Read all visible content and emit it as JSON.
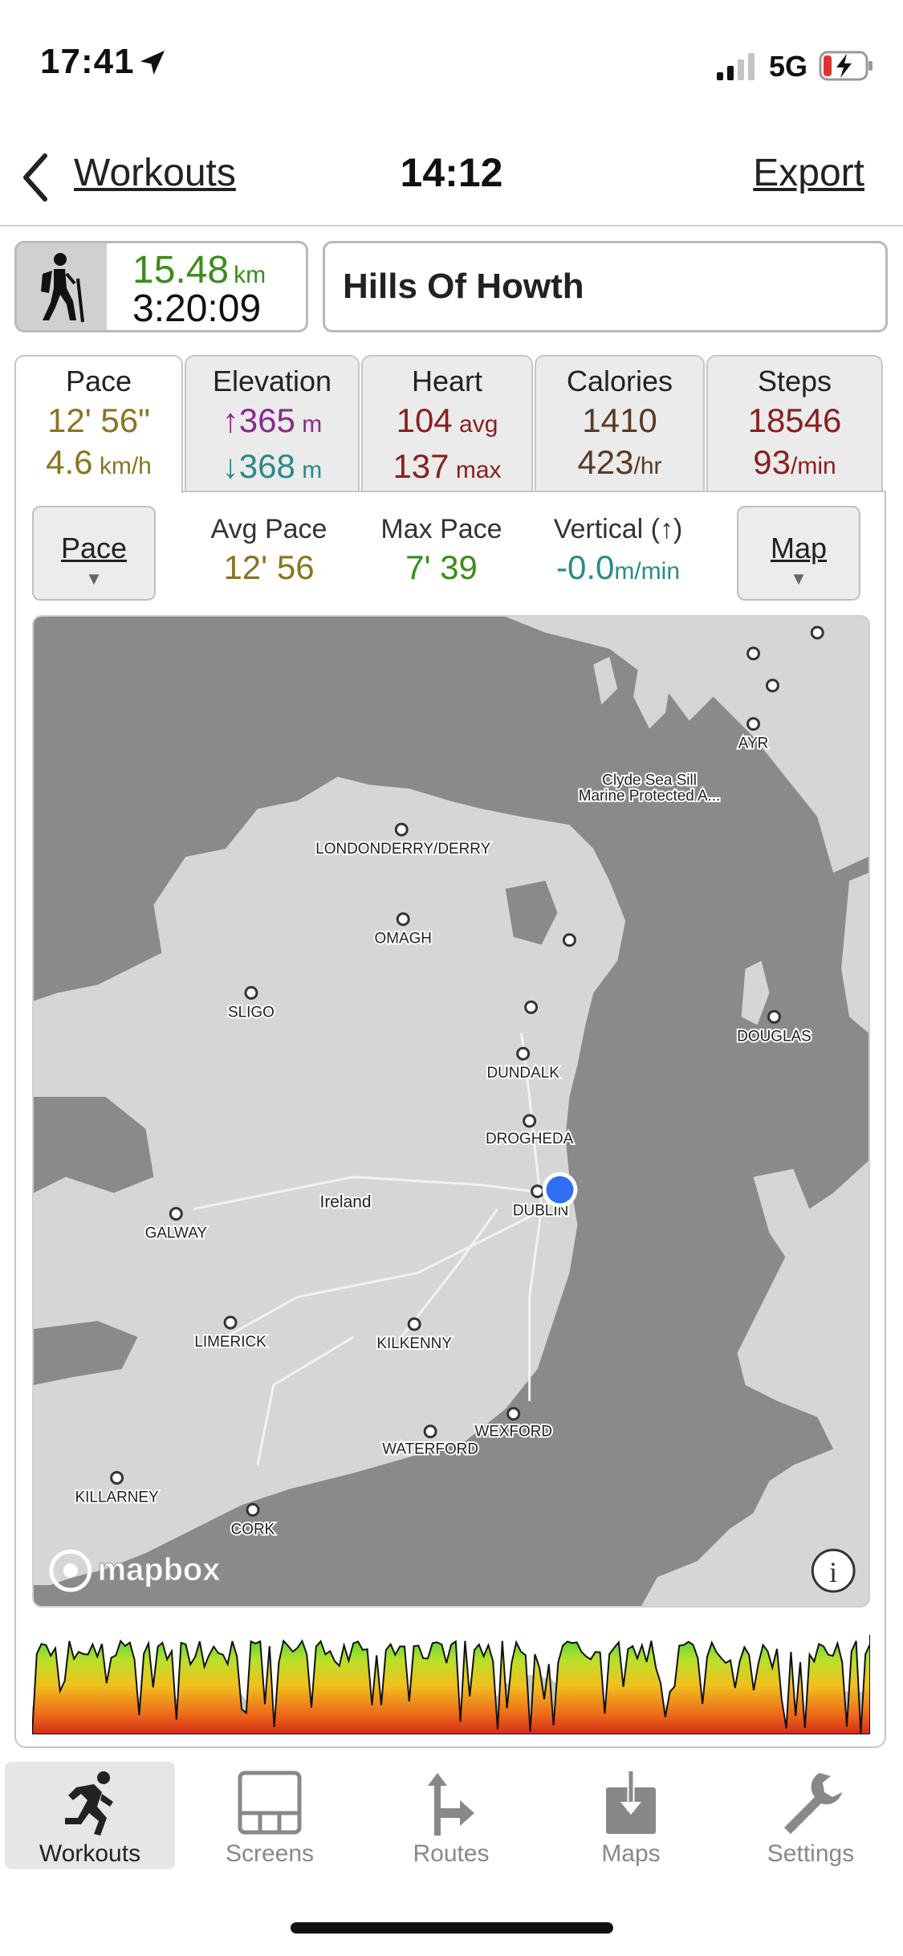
{
  "status_bar": {
    "time": "17:41",
    "network": "5G",
    "icons": [
      "location-arrow-icon",
      "signal-icon",
      "battery-charging-icon"
    ]
  },
  "nav": {
    "back_label": "Workouts",
    "title": "14:12",
    "export_label": "Export"
  },
  "summary": {
    "activity_icon": "hiking-icon",
    "distance": "15.48",
    "distance_unit": "km",
    "duration": "3:20:09",
    "workout_name": "Hills Of Howth"
  },
  "tabs": {
    "pace": {
      "label": "Pace",
      "line1": "12' 56\"",
      "line2": "4.6",
      "line2_unit": " km/h"
    },
    "elevation": {
      "label": "Elevation",
      "ascent": "↑365",
      "ascent_unit": " m",
      "descent": "↓368",
      "descent_unit": " m"
    },
    "heart": {
      "label": "Heart",
      "avg": "104",
      "avg_unit": " avg",
      "max": "137",
      "max_unit": " max"
    },
    "calories": {
      "label": "Calories",
      "total": "1410",
      "rate": "423",
      "rate_unit": "/hr"
    },
    "steps": {
      "label": "Steps",
      "total": "18546",
      "rate": "93",
      "rate_unit": "/min"
    }
  },
  "detail": {
    "left_selector": "Pace",
    "right_selector": "Map",
    "metrics": [
      {
        "label": "Avg Pace",
        "value": "12' 56",
        "unit": ""
      },
      {
        "label": "Max Pace",
        "value": "7' 39",
        "unit": ""
      },
      {
        "label": "Vertical (↑)",
        "value": "-0.0",
        "unit": "m/min"
      }
    ]
  },
  "map": {
    "places": [
      "LONDONDERRY/DERRY",
      "OMAGH",
      "SLIGO",
      "DUNDALK",
      "DROGHEDA",
      "DUBLIN",
      "GALWAY",
      "Ireland",
      "LIMERICK",
      "KILKENNY",
      "WEXFORD",
      "WATERFORD",
      "KILLARNEY",
      "CORK",
      "AYR",
      "DOUGLAS"
    ],
    "marine_line1": "Clyde Sea Sill",
    "marine_line2": "Marine Protected A...",
    "attribution": "mapbox",
    "info_icon": "info-icon"
  },
  "tab_bar": {
    "items": [
      {
        "label": "Workouts",
        "icon": "running-icon"
      },
      {
        "label": "Screens",
        "icon": "screens-icon"
      },
      {
        "label": "Routes",
        "icon": "routes-icon"
      },
      {
        "label": "Maps",
        "icon": "maps-icon"
      },
      {
        "label": "Settings",
        "icon": "wrench-icon"
      }
    ]
  },
  "colors": {
    "pace": "#8a7420",
    "distance": "#3b8d1c",
    "elevation_up": "#8a2a8c",
    "elevation_down": "#2a8a8a",
    "heart": "#8a1f1f",
    "calories": "#5a3a24",
    "steps": "#8a1f1f",
    "max_pace": "#3b8d1c",
    "vertical": "#2a8a8a",
    "location_dot": "#2f6ef5"
  }
}
